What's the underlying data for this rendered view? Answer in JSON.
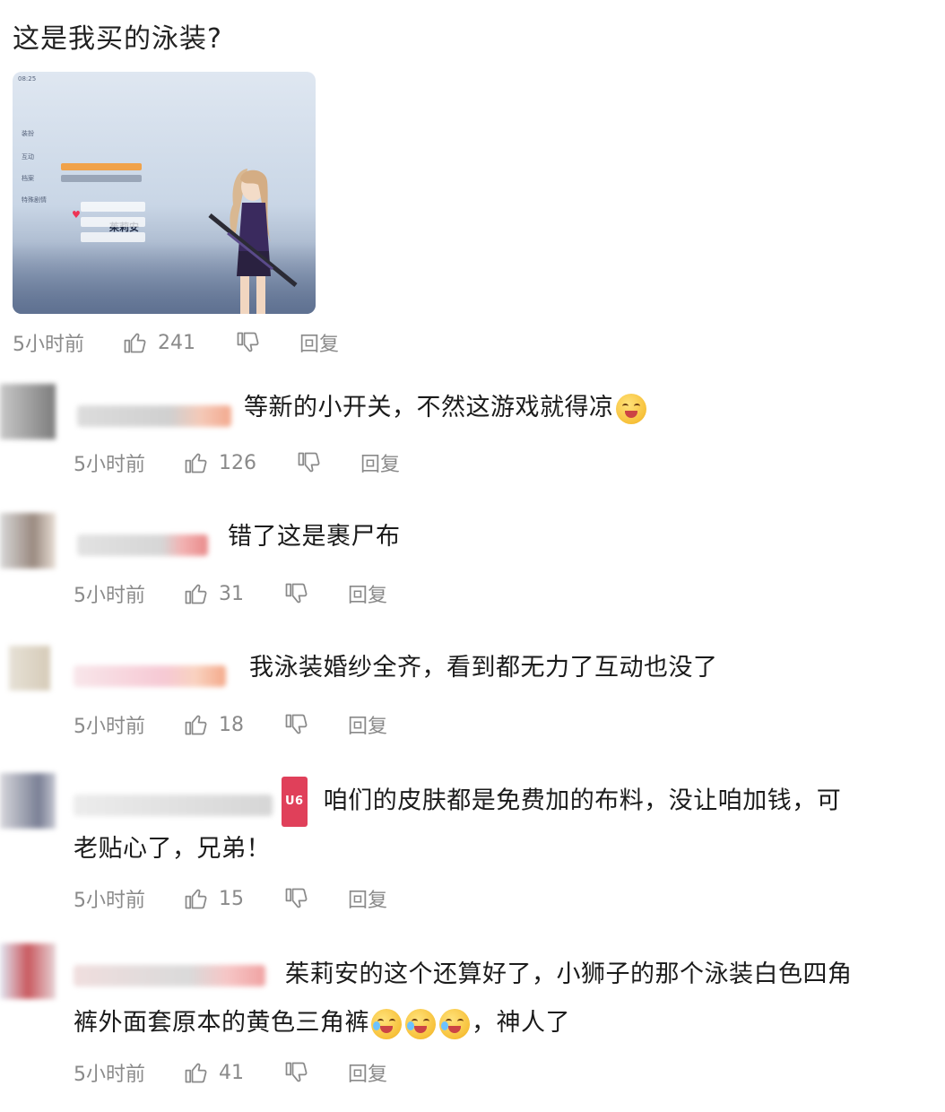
{
  "post": {
    "title": "这是我买的泳装?",
    "screenshot": {
      "character_name": "茱莉安",
      "menu_items": [
        "装扮",
        "互动",
        "档案",
        "特殊剧情"
      ]
    },
    "time": "5小时前",
    "likes": "241",
    "reply_label": "回复"
  },
  "comments": [
    {
      "text": "等新的小开关，不然这游戏就得凉",
      "emoji": "drooling-face-icon",
      "time": "5小时前",
      "likes": "126",
      "reply_label": "回复"
    },
    {
      "text": "错了这是裹尸布",
      "time": "5小时前",
      "likes": "31",
      "reply_label": "回复"
    },
    {
      "text": "我泳装婚纱全齐，看到都无力了互动也没了",
      "time": "5小时前",
      "likes": "18",
      "reply_label": "回复"
    },
    {
      "badge": "U6",
      "text_line1": "咱们的皮肤都是免费加的布料，没让咱加钱，可",
      "text_line2": "老贴心了，兄弟！",
      "time": "5小时前",
      "likes": "15",
      "reply_label": "回复"
    },
    {
      "text_line1": "茱莉安的这个还算好了，小狮子的那个泳装白色四角",
      "text_line2": "裤外面套原本的黄色三角裤",
      "text_line2_end": "，神人了",
      "emoji": "crying-laughing-icon",
      "time": "5小时前",
      "likes": "41",
      "reply_label": "回复"
    }
  ]
}
